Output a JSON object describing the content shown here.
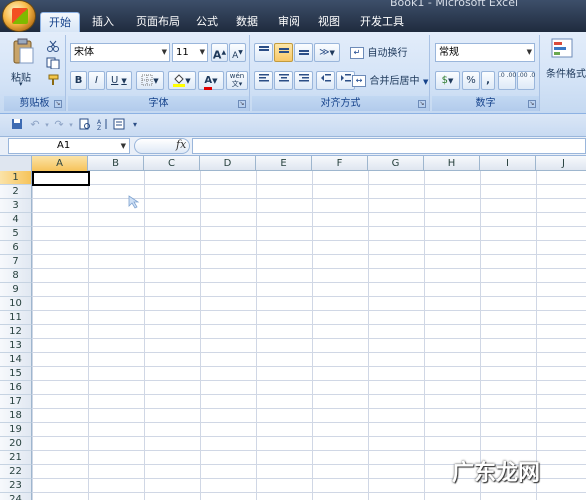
{
  "window": {
    "title": "Book1 - Microsoft Excel"
  },
  "tabs": [
    {
      "label": "开始",
      "active": true
    },
    {
      "label": "插入"
    },
    {
      "label": "页面布局"
    },
    {
      "label": "公式"
    },
    {
      "label": "数据"
    },
    {
      "label": "审阅"
    },
    {
      "label": "视图"
    },
    {
      "label": "开发工具"
    }
  ],
  "ribbon": {
    "clipboard": {
      "label": "剪贴板",
      "paste": "粘贴"
    },
    "font": {
      "label": "字体",
      "font_name": "宋体",
      "font_size": "11",
      "grow": "A",
      "shrink": "A",
      "bold": "B",
      "italic": "I",
      "underline": "U",
      "phonetic": "wén"
    },
    "alignment": {
      "label": "对齐方式",
      "wrap_text": "自动换行",
      "merge_center": "合并后居中"
    },
    "number": {
      "label": "数字",
      "format": "常规",
      "percent": "%",
      "comma": ",",
      "inc_decimal": ".0 .00",
      "dec_decimal": ".00 .0"
    },
    "styles": {
      "conditional": "条件格式"
    }
  },
  "formula_bar": {
    "name_box": "A1",
    "fx": "fx",
    "content": ""
  },
  "grid": {
    "columns": [
      "A",
      "B",
      "C",
      "D",
      "E",
      "F",
      "G",
      "H",
      "I",
      "J"
    ],
    "rows": [
      "1",
      "2",
      "3",
      "4",
      "5",
      "6",
      "7",
      "8",
      "9",
      "10",
      "11",
      "12",
      "13",
      "14",
      "15",
      "16",
      "17",
      "18",
      "19",
      "20",
      "21",
      "22",
      "23",
      "24"
    ],
    "active_cell": "A1"
  },
  "watermark": "广东龙网"
}
